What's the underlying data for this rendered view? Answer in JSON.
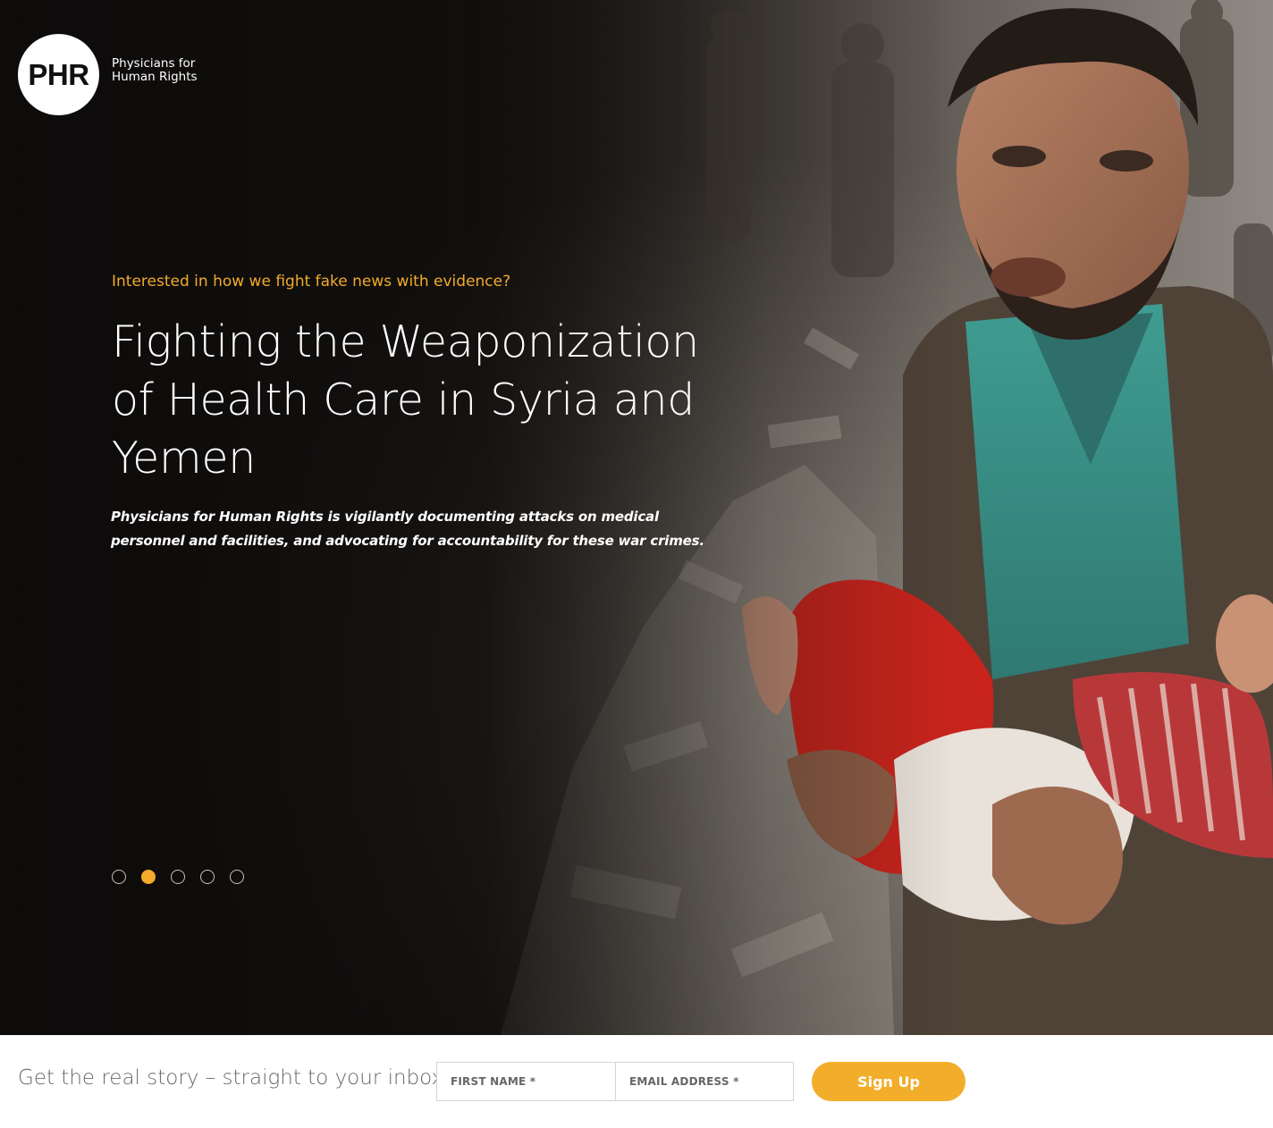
{
  "logo": {
    "mark": "PHR",
    "line1": "Physicians for",
    "line2": "Human Rights"
  },
  "hero": {
    "eyebrow": "Interested in how we fight fake news with evidence?",
    "headline": "Fighting the Weaponization of Health Care in Syria and Yemen",
    "lede": "Physicians for Human Rights is vigilantly documenting attacks on medical personnel and facilities, and advocating for accountability for these war crimes.",
    "slides": {
      "count": 5,
      "active_index": 2
    }
  },
  "signup": {
    "label": "Get the real story – straight to your inbox:",
    "first_name_placeholder": "FIRST NAME *",
    "email_placeholder": "EMAIL ADDRESS *",
    "button_label": "Sign Up"
  },
  "colors": {
    "accent": "#f2ab2b",
    "hero_dark": "#1b1917",
    "label_text": "#6b6866"
  }
}
